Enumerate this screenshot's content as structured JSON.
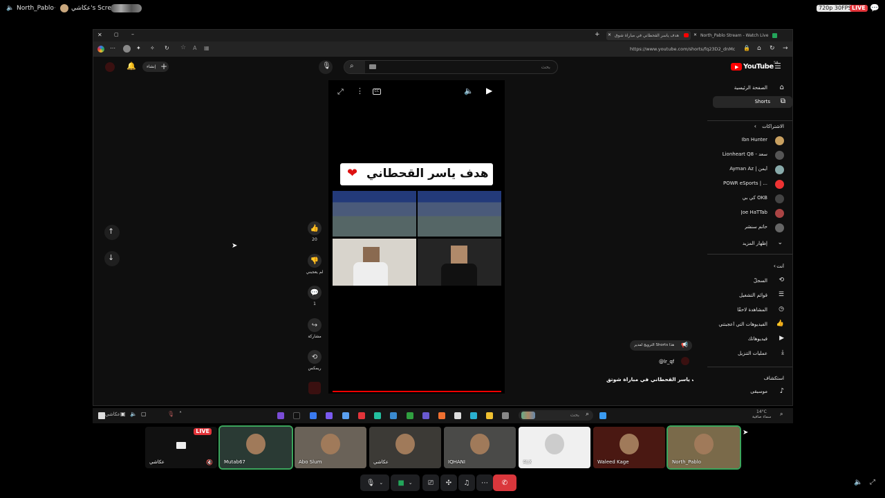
{
  "discord": {
    "streamer": "North_Pablo",
    "screen_title": "عكاشي's Screen",
    "quality": "720p 30FPS",
    "live": "LIVE"
  },
  "browser": {
    "tabs": [
      {
        "label": "هدف ياسر القحطاني في مباراة شوق"
      },
      {
        "label": "North_Pablo Stream - Watch Live"
      }
    ],
    "url": "https://www.youtube.com/shorts/fq23D2_dnMc"
  },
  "youtube": {
    "logo": "YouTube",
    "logo_sup": "SA",
    "search_placeholder": "بحث",
    "create_label": "إنشاء",
    "nav": [
      {
        "label": "الصفحة الرئيسية",
        "icon": "home-icon"
      },
      {
        "label": "Shorts",
        "icon": "shorts-icon"
      }
    ],
    "subs_header": "الاشتراكات",
    "subscriptions": [
      "Ibn Hunter",
      "Lionheart Q8 - سعد",
      "Ayman Az | أيمن",
      "POWR eSports | ...",
      "كي بي OKB",
      "Joe HaTTab",
      "حاتم سنشر"
    ],
    "show_more": "إظهار المزيد",
    "you_header": "أنت",
    "you_items": [
      {
        "label": "السجلّ",
        "icon": "history-icon"
      },
      {
        "label": "قوائم التشغيل",
        "icon": "playlist-icon"
      },
      {
        "label": "المشاهدة لاحقًا",
        "icon": "clock-icon"
      },
      {
        "label": "الفيديوهات التي أعجبتني",
        "icon": "like-icon"
      },
      {
        "label": "فيديوهاتك",
        "icon": "video-icon"
      },
      {
        "label": "عمليات التنزيل",
        "icon": "download-icon"
      }
    ],
    "explore_header": "استكشاف",
    "explore_items": [
      {
        "label": "موسيقى",
        "icon": "music-icon"
      }
    ],
    "short": {
      "title_overlay": "هدف ياسر القحطاني",
      "likes": "20",
      "dislike_label": "لم يعجبني",
      "comments": "1",
      "share_label": "مشاركة",
      "remix_label": "ريمكس",
      "channel": "@lr_qf",
      "description": "هدف ياسر القحطاني في مباراة شوتق",
      "promo": "الترويج لمدير Shorts هذا"
    }
  },
  "taskbar": {
    "search_placeholder": "بحث",
    "weather_temp": "14°C",
    "weather_desc": "سماء صافية",
    "app_label": "عكاشي"
  },
  "participants": [
    {
      "name": "عكاشي",
      "type": "screen",
      "live": "LIVE",
      "color": "#111111"
    },
    {
      "name": "Mutab67",
      "color": "#2a3a34"
    },
    {
      "name": "Abo Slum",
      "color": "#6a6258"
    },
    {
      "name": "عكاشي",
      "color": "#3c3a36"
    },
    {
      "name": "IQHANI",
      "color": "#4a4a48"
    },
    {
      "name": "ALX",
      "color": "#f0f0f0"
    },
    {
      "name": "Waleed Kage",
      "color": "#4a1812"
    },
    {
      "name": "North_Pablo",
      "color": "#7a6a4a"
    }
  ],
  "colors": {
    "accent_red": "#e3343a",
    "youtube_red": "#ff0000",
    "green": "#23a55a"
  }
}
